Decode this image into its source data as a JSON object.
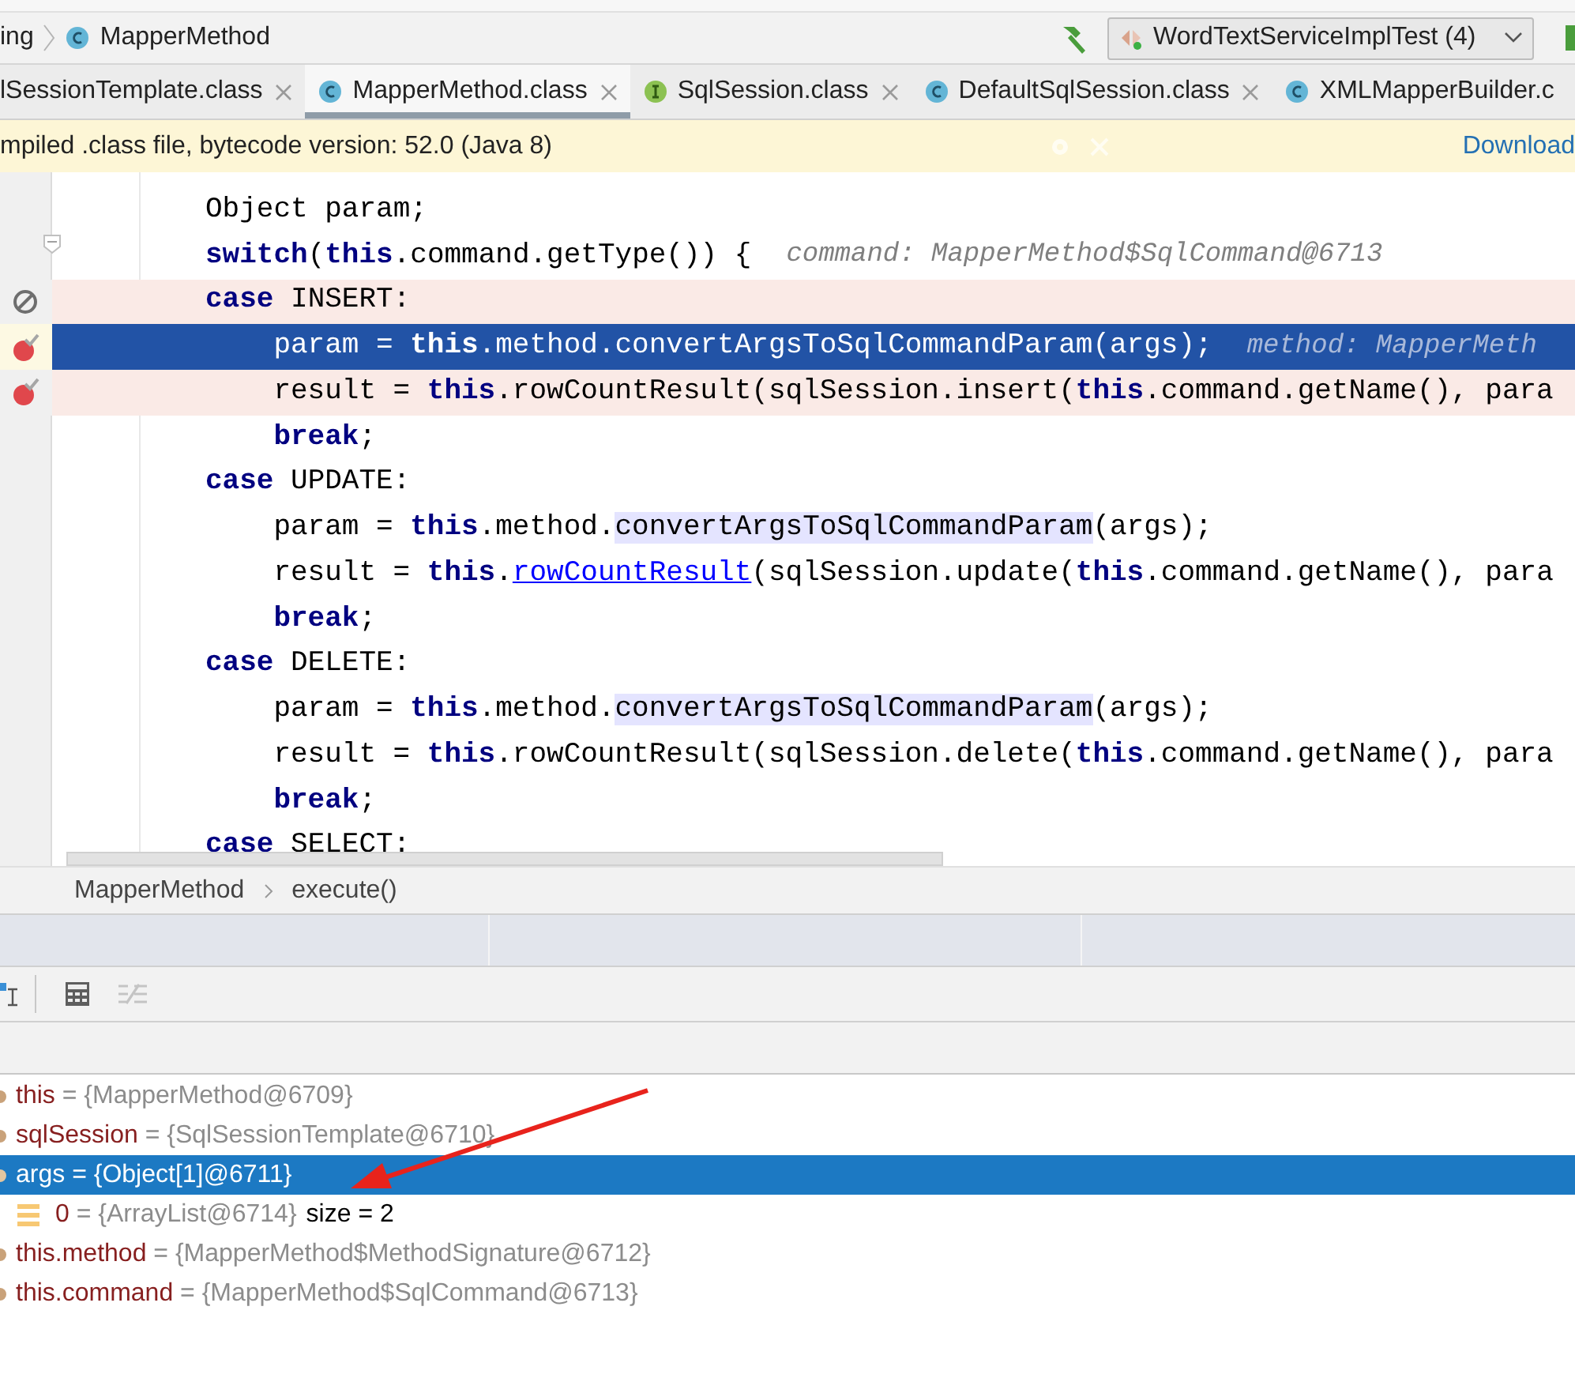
{
  "nav_bar": {
    "crumbs": [
      "ing",
      "MapperMethod"
    ],
    "run_config": "WordTextServiceImplTest (4)"
  },
  "tabs": [
    {
      "label": "lSessionTemplate.class",
      "selected": false,
      "closable": true
    },
    {
      "label": "MapperMethod.class",
      "selected": true,
      "kind": "class",
      "closable": true
    },
    {
      "label": "SqlSession.class",
      "selected": false,
      "kind": "interface",
      "closable": true
    },
    {
      "label": "DefaultSqlSession.class",
      "selected": false,
      "kind": "class",
      "closable": true
    },
    {
      "label": "XMLMapperBuilder.c",
      "selected": false,
      "kind": "class",
      "closable": false
    }
  ],
  "banner": {
    "text": "mpiled .class file, bytecode version: 52.0 (Java 8)",
    "link": "Download"
  },
  "code_lines": [
    {
      "tokens": [
        {
          "text": "Object param;",
          "kind": "plain"
        }
      ],
      "current": false,
      "breakpoint": false
    },
    {
      "tokens": [
        {
          "text": "switch",
          "kind": "keyword"
        },
        {
          "text": "(",
          "kind": "plain"
        },
        {
          "text": "this",
          "kind": "keyword"
        },
        {
          "text": ".command.getType()) {",
          "kind": "plain"
        }
      ],
      "hint": "command: MapperMethod$SqlCommand@6713",
      "current": false,
      "breakpoint": false,
      "fold_marker": true
    },
    {
      "tokens": [
        {
          "text": "case",
          "kind": "keyword"
        },
        {
          "text": " INSERT:",
          "kind": "plain"
        }
      ],
      "current": false,
      "breakpoint": true,
      "muted": true,
      "children": [
        {
          "tokens": [
            {
              "text": "param = ",
              "kind": "plain"
            },
            {
              "text": "this",
              "kind": "keyword"
            },
            {
              "text": ".method.convertArgsToSqlCommandParam(args);",
              "kind": "plain"
            }
          ],
          "hint": "method: MapperMeth",
          "current": true,
          "breakpoint": true,
          "muted": false
        },
        {
          "tokens": [
            {
              "text": "result = ",
              "kind": "plain"
            },
            {
              "text": "this",
              "kind": "keyword"
            },
            {
              "text": ".rowCountResult(sqlSession.insert(",
              "kind": "plain"
            },
            {
              "text": "this",
              "kind": "keyword"
            },
            {
              "text": ".command.getName(), para",
              "kind": "plain"
            }
          ],
          "current": false,
          "breakpoint": true,
          "muted": false
        },
        {
          "tokens": [
            {
              "text": "break",
              "kind": "keyword"
            },
            {
              "text": ";",
              "kind": "plain"
            }
          ],
          "current": false,
          "breakpoint": false
        }
      ]
    },
    {
      "tokens": [
        {
          "text": "case",
          "kind": "keyword"
        },
        {
          "text": " UPDATE:",
          "kind": "plain"
        }
      ],
      "current": false,
      "breakpoint": false,
      "children": [
        {
          "tokens": [
            {
              "text": "param = ",
              "kind": "plain"
            },
            {
              "text": "this",
              "kind": "keyword"
            },
            {
              "text": ".method.",
              "kind": "plain"
            },
            {
              "text": "convertArgsToSqlCommandParam",
              "kind": "highlight"
            },
            {
              "text": "(args);",
              "kind": "plain"
            }
          ],
          "current": false,
          "breakpoint": false
        },
        {
          "tokens": [
            {
              "text": "result = ",
              "kind": "plain"
            },
            {
              "text": "this",
              "kind": "keyword"
            },
            {
              "text": ".",
              "kind": "plain"
            },
            {
              "text": "rowCountResult",
              "kind": "link"
            },
            {
              "text": "(sqlSession.update(",
              "kind": "plain"
            },
            {
              "text": "this",
              "kind": "keyword"
            },
            {
              "text": ".command.getName(), para",
              "kind": "plain"
            }
          ],
          "current": false,
          "breakpoint": false
        },
        {
          "tokens": [
            {
              "text": "break",
              "kind": "keyword"
            },
            {
              "text": ";",
              "kind": "plain"
            }
          ],
          "current": false,
          "breakpoint": false
        }
      ]
    },
    {
      "tokens": [
        {
          "text": "case",
          "kind": "keyword"
        },
        {
          "text": " DELETE:",
          "kind": "plain"
        }
      ],
      "current": false,
      "breakpoint": false,
      "children": [
        {
          "tokens": [
            {
              "text": "param = ",
              "kind": "plain"
            },
            {
              "text": "this",
              "kind": "keyword"
            },
            {
              "text": ".method.",
              "kind": "plain"
            },
            {
              "text": "convertArgsToSqlCommandParam",
              "kind": "highlight"
            },
            {
              "text": "(args);",
              "kind": "plain"
            }
          ],
          "current": false,
          "breakpoint": false
        },
        {
          "tokens": [
            {
              "text": "result = ",
              "kind": "plain"
            },
            {
              "text": "this",
              "kind": "keyword"
            },
            {
              "text": ".rowCountResult(sqlSession.delete(",
              "kind": "plain"
            },
            {
              "text": "this",
              "kind": "keyword"
            },
            {
              "text": ".command.getName(), para",
              "kind": "plain"
            }
          ],
          "current": false,
          "breakpoint": false
        },
        {
          "tokens": [
            {
              "text": "break",
              "kind": "keyword"
            },
            {
              "text": ";",
              "kind": "plain"
            }
          ],
          "current": false,
          "breakpoint": false
        }
      ]
    },
    {
      "tokens": [
        {
          "text": "case",
          "kind": "keyword"
        },
        {
          "text": " SELECT:",
          "kind": "plain"
        }
      ],
      "current": false,
      "breakpoint": false
    }
  ],
  "editor_breadcrumb": [
    "MapperMethod",
    "execute()"
  ],
  "toolbar": [
    {
      "kind": "cursor",
      "disabled": false
    },
    {
      "kind": "calculator",
      "disabled": false
    },
    {
      "kind": "compare",
      "disabled": true
    }
  ],
  "variables": [
    {
      "name": "this",
      "value": "= {MapperMethod@6709}",
      "kind": "field",
      "selected": false
    },
    {
      "name": "sqlSession",
      "value": "= {SqlSessionTemplate@6710}",
      "kind": "field",
      "selected": false
    },
    {
      "name": "args",
      "value": "= {Object[1]@6711}",
      "kind": "field",
      "selected": true,
      "children": [
        {
          "name": "0",
          "value": "= {ArrayList@6714}",
          "extra": "size = 2",
          "kind": "array-element",
          "selected": false
        }
      ]
    },
    {
      "name": "this.method",
      "value": "= {MapperMethod$MethodSignature@6712}",
      "kind": "field",
      "selected": false
    },
    {
      "name": "this.command",
      "value": "= {MapperMethod$SqlCommand@6713}",
      "kind": "field",
      "selected": false
    }
  ]
}
